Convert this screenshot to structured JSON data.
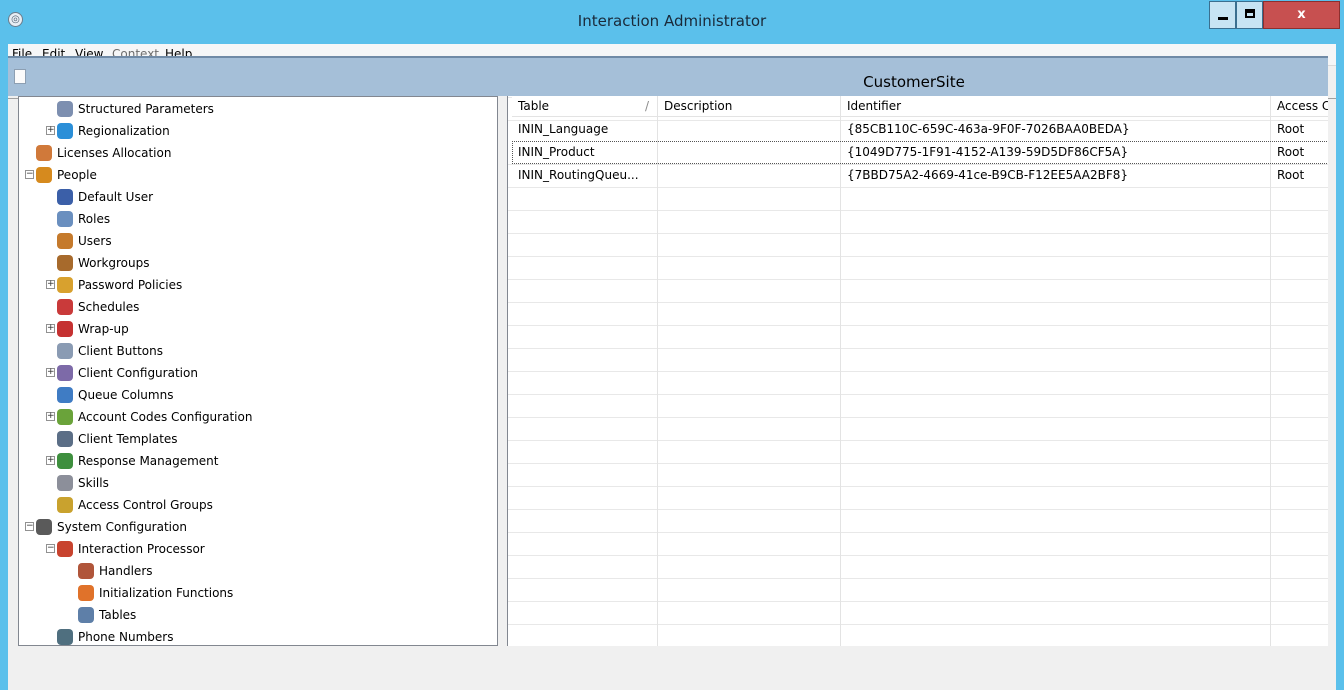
{
  "window": {
    "title": "Interaction Administrator",
    "close_label": "x"
  },
  "menu": [
    "File",
    "Edit",
    "View",
    "Context",
    "Help"
  ],
  "toolbar": {
    "buttons": [
      {
        "icon": "new-icon",
        "enabled": true
      },
      {
        "icon": "edit-icon",
        "enabled": false
      },
      {
        "icon": "delete-icon",
        "enabled": false
      },
      {
        "icon": "copy-icon",
        "enabled": false
      },
      {
        "icon": "paste-icon",
        "enabled": false
      },
      {
        "icon": "refresh-icon",
        "enabled": true
      },
      {
        "icon": "filter-icon",
        "enabled": true
      },
      {
        "icon": "properties-icon",
        "enabled": true
      }
    ]
  },
  "view": {
    "title": "CustomerSite"
  },
  "tree": [
    {
      "label": "Structured Parameters",
      "icon": "structured-parameters-icon",
      "color": "#7d8fb0",
      "level": 2,
      "expander": ""
    },
    {
      "label": "Regionalization",
      "icon": "globe-icon",
      "color": "#2b8fd8",
      "level": 2,
      "expander": "+"
    },
    {
      "label": "Licenses Allocation",
      "icon": "license-icon",
      "color": "#d0793a",
      "level": 1,
      "expander": ""
    },
    {
      "label": "People",
      "icon": "people-icon",
      "color": "#d68a1e",
      "level": 1,
      "expander": "-"
    },
    {
      "label": "Default User",
      "icon": "default-user-icon",
      "color": "#3b5fa8",
      "level": 2,
      "expander": ""
    },
    {
      "label": "Roles",
      "icon": "roles-icon",
      "color": "#6a8fbf",
      "level": 2,
      "expander": ""
    },
    {
      "label": "Users",
      "icon": "user-icon",
      "color": "#c57a2c",
      "level": 2,
      "expander": ""
    },
    {
      "label": "Workgroups",
      "icon": "workgroups-icon",
      "color": "#a76a2c",
      "level": 2,
      "expander": ""
    },
    {
      "label": "Password Policies",
      "icon": "key-icon",
      "color": "#d8a12e",
      "level": 2,
      "expander": "+"
    },
    {
      "label": "Schedules",
      "icon": "calendar-icon",
      "color": "#c93a3a",
      "level": 2,
      "expander": ""
    },
    {
      "label": "Wrap-up",
      "icon": "wrap-up-icon",
      "color": "#c53131",
      "level": 2,
      "expander": "+"
    },
    {
      "label": "Client Buttons",
      "icon": "client-buttons-icon",
      "color": "#8a9bb3",
      "level": 2,
      "expander": ""
    },
    {
      "label": "Client Configuration",
      "icon": "client-configuration-icon",
      "color": "#7d6aa8",
      "level": 2,
      "expander": "+"
    },
    {
      "label": "Queue Columns",
      "icon": "queue-columns-icon",
      "color": "#3f7cc4",
      "level": 2,
      "expander": ""
    },
    {
      "label": "Account Codes Configuration",
      "icon": "account-codes-icon",
      "color": "#6aa33a",
      "level": 2,
      "expander": "+"
    },
    {
      "label": "Client Templates",
      "icon": "client-templates-icon",
      "color": "#5b6e86",
      "level": 2,
      "expander": ""
    },
    {
      "label": "Response Management",
      "icon": "response-management-icon",
      "color": "#3e8f3e",
      "level": 2,
      "expander": "+"
    },
    {
      "label": "Skills",
      "icon": "skills-icon",
      "color": "#8c8f9a",
      "level": 2,
      "expander": ""
    },
    {
      "label": "Access Control Groups",
      "icon": "access-control-icon",
      "color": "#c9a22e",
      "level": 2,
      "expander": ""
    },
    {
      "label": "System Configuration",
      "icon": "system-configuration-icon",
      "color": "#5a5a5a",
      "level": 1,
      "expander": "-"
    },
    {
      "label": "Interaction Processor",
      "icon": "interaction-processor-icon",
      "color": "#c8432e",
      "level": 2,
      "expander": "-"
    },
    {
      "label": "Handlers",
      "icon": "handlers-icon",
      "color": "#b0553a",
      "level": 3,
      "expander": ""
    },
    {
      "label": "Initialization Functions",
      "icon": "initialization-icon",
      "color": "#e0722a",
      "level": 3,
      "expander": ""
    },
    {
      "label": "Tables",
      "icon": "table-icon",
      "color": "#5e7fa8",
      "level": 3,
      "expander": ""
    },
    {
      "label": "Phone Numbers",
      "icon": "phone-icon",
      "color": "#4f6f7f",
      "level": 2,
      "expander": ""
    }
  ],
  "grid": {
    "columns": [
      "Table",
      "Description",
      "Identifier",
      "Access C"
    ],
    "rows": [
      {
        "table": "ININ_Language",
        "description": "",
        "identifier": "{85CB110C-659C-463a-9F0F-7026BAA0BEDA}",
        "access": "Root"
      },
      {
        "table": "ININ_Product",
        "description": "",
        "identifier": "{1049D775-1F91-4152-A139-59D5DF86CF5A}",
        "access": "Root"
      },
      {
        "table": "ININ_RoutingQueu...",
        "description": "",
        "identifier": "{7BBD75A2-4669-41ce-B9CB-F12EE5AA2BF8}",
        "access": "Root"
      }
    ]
  }
}
